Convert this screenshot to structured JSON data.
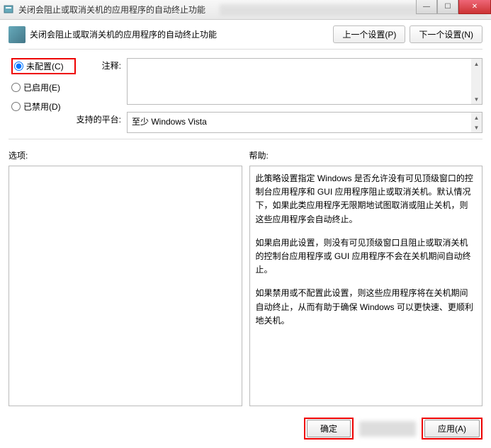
{
  "titlebar": {
    "title": "关闭会阻止或取消关机的应用程序的自动终止功能"
  },
  "header": {
    "policy_title": "关闭会阻止或取消关机的应用程序的自动终止功能",
    "prev_btn": "上一个设置(P)",
    "next_btn": "下一个设置(N)"
  },
  "radios": {
    "not_configured": "未配置(C)",
    "enabled": "已启用(E)",
    "disabled": "已禁用(D)"
  },
  "fields": {
    "comment_label": "注释:",
    "comment_value": "",
    "platform_label": "支持的平台:",
    "platform_value": "至少 Windows Vista"
  },
  "lower": {
    "options_label": "选项:",
    "help_label": "帮助:"
  },
  "help": {
    "p1": "此策略设置指定 Windows 是否允许没有可见顶级窗口的控制台应用程序和 GUI 应用程序阻止或取消关机。默认情况下，如果此类应用程序无限期地试图取消或阻止关机，则这些应用程序会自动终止。",
    "p2": "如果启用此设置，则没有可见顶级窗口且阻止或取消关机的控制台应用程序或 GUI 应用程序不会在关机期间自动终止。",
    "p3": "如果禁用或不配置此设置，则这些应用程序将在关机期间自动终止，从而有助于确保 Windows 可以更快速、更顺利地关机。"
  },
  "footer": {
    "ok": "确定",
    "apply": "应用(A)"
  }
}
